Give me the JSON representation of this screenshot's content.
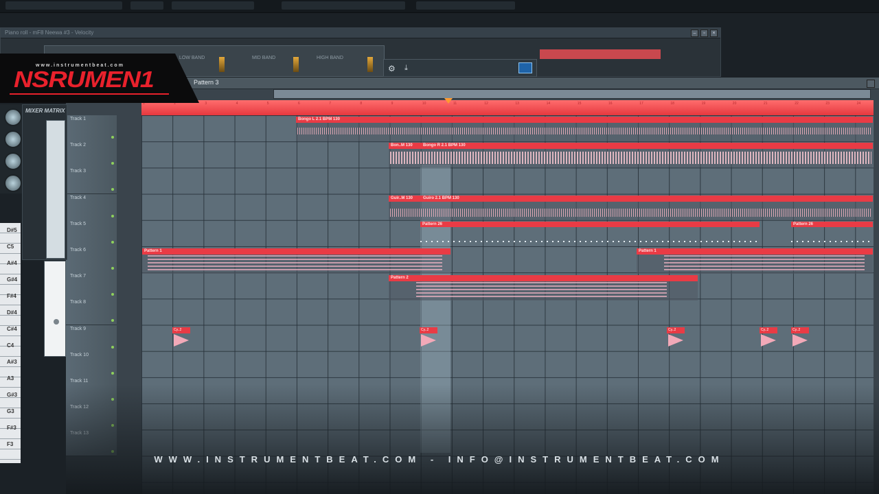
{
  "app": {
    "window_title": "Piano roll - mF8 Neewa #3 - Velocity",
    "pattern_selector": "Pattern 3"
  },
  "logo": {
    "url_text": "www.instrumentbeat.com",
    "wordmark": "NSRUMEN1"
  },
  "mixer": {
    "title": "MIXER MATRIX"
  },
  "toolbar_panels": [
    "LOW BAND",
    "MID BAND",
    "HIGH BAND"
  ],
  "timeline": {
    "ticks": [
      "1",
      "2",
      "3",
      "4",
      "5",
      "6",
      "7",
      "8",
      "9",
      "10",
      "11",
      "12",
      "13",
      "14",
      "15",
      "16",
      "17",
      "18",
      "19",
      "20",
      "21",
      "22",
      "23",
      "24"
    ]
  },
  "tracks": [
    {
      "label": "Track 1"
    },
    {
      "label": "Track 2"
    },
    {
      "label": "Track 3"
    },
    {
      "label": "Track 4"
    },
    {
      "label": "Track 5"
    },
    {
      "label": "Track 6"
    },
    {
      "label": "Track 7"
    },
    {
      "label": "Track 8"
    },
    {
      "label": "Track 9"
    },
    {
      "label": "Track 10"
    },
    {
      "label": "Track 11"
    },
    {
      "label": "Track 12"
    },
    {
      "label": "Track 13"
    }
  ],
  "clips": {
    "bongo_l": "Bongo L 2.1 BPM 130",
    "bongo_l_short": "Bon..M 130",
    "bongo_r": "Bongo R 2.1 BPM 130",
    "bongo_r_short": "Bon..M 130",
    "guiro": "Guiro 2.1 BPM 130",
    "guiro_short": "Guir..M 130",
    "pattern26": "Pattern 26",
    "pattern1": "Pattern 1",
    "pattern2": "Pattern 2",
    "cymbal": "Cy..2"
  },
  "piano_keys": [
    "D#5",
    "C5",
    "A#4",
    "G#4",
    "F#4",
    "D#4",
    "C#4",
    "C4",
    "A#3",
    "A3",
    "G#3",
    "G3",
    "F#3",
    "F3"
  ],
  "footer": "WWW.INSTRUMENTBEAT.COM - INFO@INSTRUMENTBEAT.COM"
}
